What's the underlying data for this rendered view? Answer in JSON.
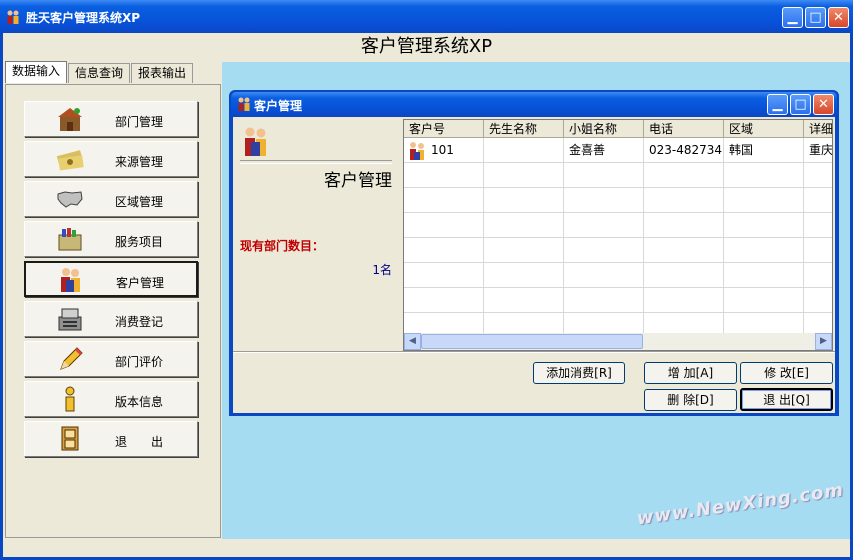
{
  "window": {
    "title": "胜天客户管理系统XP",
    "min_label": "▁",
    "max_label": "□",
    "close_label": "✕"
  },
  "app": {
    "header": "客户管理系统XP"
  },
  "tabs": [
    {
      "label": "数据输入"
    },
    {
      "label": "信息查询"
    },
    {
      "label": "报表输出"
    }
  ],
  "nav": [
    {
      "label": "部门管理",
      "icon": "house-icon"
    },
    {
      "label": "来源管理",
      "icon": "money-icon"
    },
    {
      "label": "区域管理",
      "icon": "map-icon"
    },
    {
      "label": "服务项目",
      "icon": "box-icon"
    },
    {
      "label": "客户管理",
      "icon": "people-icon"
    },
    {
      "label": "消费登记",
      "icon": "register-icon"
    },
    {
      "label": "部门评价",
      "icon": "pencil-icon"
    },
    {
      "label": "版本信息",
      "icon": "info-icon"
    },
    {
      "label": "退　　出",
      "icon": "exit-icon"
    }
  ],
  "child": {
    "title": "客户管理",
    "panel_title": "客户管理",
    "count_label": "现有部门数目：",
    "count_value": "1名"
  },
  "grid": {
    "columns": [
      "客户号",
      "先生名称",
      "小姐名称",
      "电话",
      "区域",
      "详细"
    ],
    "rows": [
      [
        "101",
        "",
        "金喜善",
        "023-482734...",
        "韩国",
        "重庆"
      ]
    ]
  },
  "buttons": {
    "add_expense": "添加消费[R]",
    "add": "增  加[A]",
    "modify": "修  改[E]",
    "delete": "删  除[D]",
    "exit": "退  出[Q]"
  },
  "watermark": "www.NewXing.com",
  "colors": {
    "title_blue": "#0a5fe0",
    "workspace": "#a6dcf2",
    "highlight_red": "#c00000",
    "count_blue": "#000080"
  }
}
